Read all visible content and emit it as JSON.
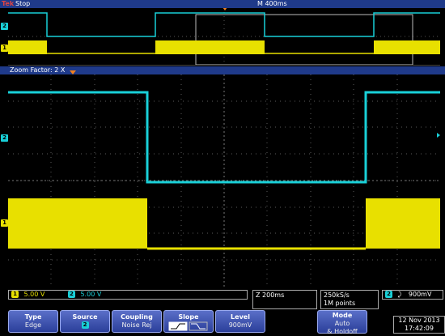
{
  "topbar": {
    "brand": "Tek",
    "state": "Stop",
    "timebase": "M 400ms"
  },
  "zoom": {
    "label": "Zoom Factor: 2 X"
  },
  "channels": {
    "ch1": {
      "number": "1",
      "scale": "5.00 V",
      "color": "#e8e000"
    },
    "ch2": {
      "number": "2",
      "scale": "5.00 V",
      "color": "#19d0d8"
    }
  },
  "readout": {
    "zoom_time": "Z 200ms",
    "sample_rate": "250kS/s",
    "record_length": "1M points",
    "trigger_source": "2",
    "trigger_level": "900mV"
  },
  "menu": {
    "type": {
      "label": "Type",
      "value": "Edge"
    },
    "source": {
      "label": "Source",
      "value": "2"
    },
    "coupling": {
      "label": "Coupling",
      "value": "Noise Rej"
    },
    "slope": {
      "label": "Slope"
    },
    "level": {
      "label": "Level",
      "value": "900mV"
    },
    "mode": {
      "label": "Mode",
      "value1": "Auto",
      "value2": "& Holdoff"
    }
  },
  "datetime": {
    "date": "12 Nov 2013",
    "time": "17:42:09"
  }
}
